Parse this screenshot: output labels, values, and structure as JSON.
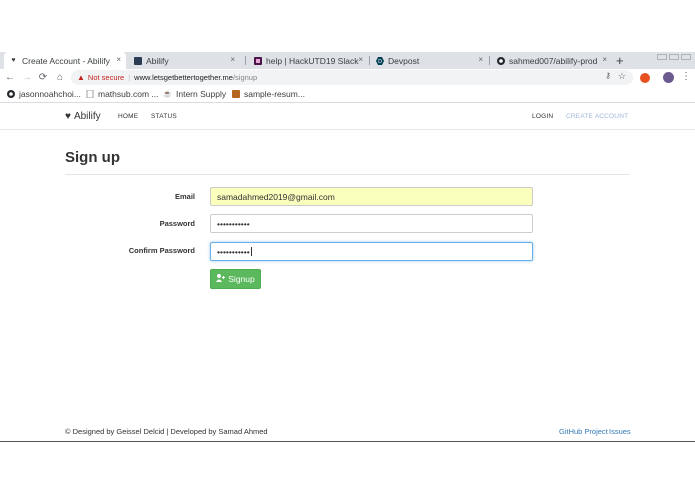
{
  "browser": {
    "tabs": [
      {
        "title": "Create Account - Abilify",
        "icon": "heart-icon",
        "active": true
      },
      {
        "title": "Abilify",
        "icon": "app-icon",
        "active": false
      },
      {
        "title": "help | HackUTD19 Slack",
        "icon": "slack-icon",
        "active": false
      },
      {
        "title": "Devpost",
        "icon": "devpost-icon",
        "active": false
      },
      {
        "title": "sahmed007/abilify-prod",
        "icon": "github-icon",
        "active": false
      }
    ],
    "close_glyph": "×",
    "new_tab_glyph": "+",
    "address": {
      "warning": "Not secure",
      "host": "www.letsgetbettertogether.me",
      "path": "/signup"
    },
    "bookmarks": [
      {
        "label": "jasonnoahchoi...",
        "icon": "github-icon"
      },
      {
        "label": "mathsub.com ...",
        "icon": "page-icon"
      },
      {
        "label": "Intern Supply",
        "icon": "intern-supply-icon"
      },
      {
        "label": "sample-resum...",
        "icon": "bookmark-icon"
      }
    ]
  },
  "site": {
    "brand": "Abilify",
    "nav": {
      "home": "HOME",
      "status": "STATUS",
      "login": "LOGIN",
      "create_account": "CREATE ACCOUNT"
    }
  },
  "form": {
    "heading": "Sign up",
    "email_label": "Email",
    "email_value": "samadahmed2019@gmail.com",
    "password_label": "Password",
    "password_value": "•••••••••••",
    "confirm_label": "Confirm Password",
    "confirm_value": "•••••••••••",
    "submit_label": "Signup"
  },
  "footer": {
    "credits": "© Designed by Geissel Delcid | Developed by Samad Ahmed",
    "github_link": "GitHub Project",
    "issues_link": "Issues"
  },
  "colors": {
    "accent": "#5cb85c",
    "link": "#337ab7",
    "autofill": "#faffbd",
    "not_secure": "#c5221f"
  }
}
